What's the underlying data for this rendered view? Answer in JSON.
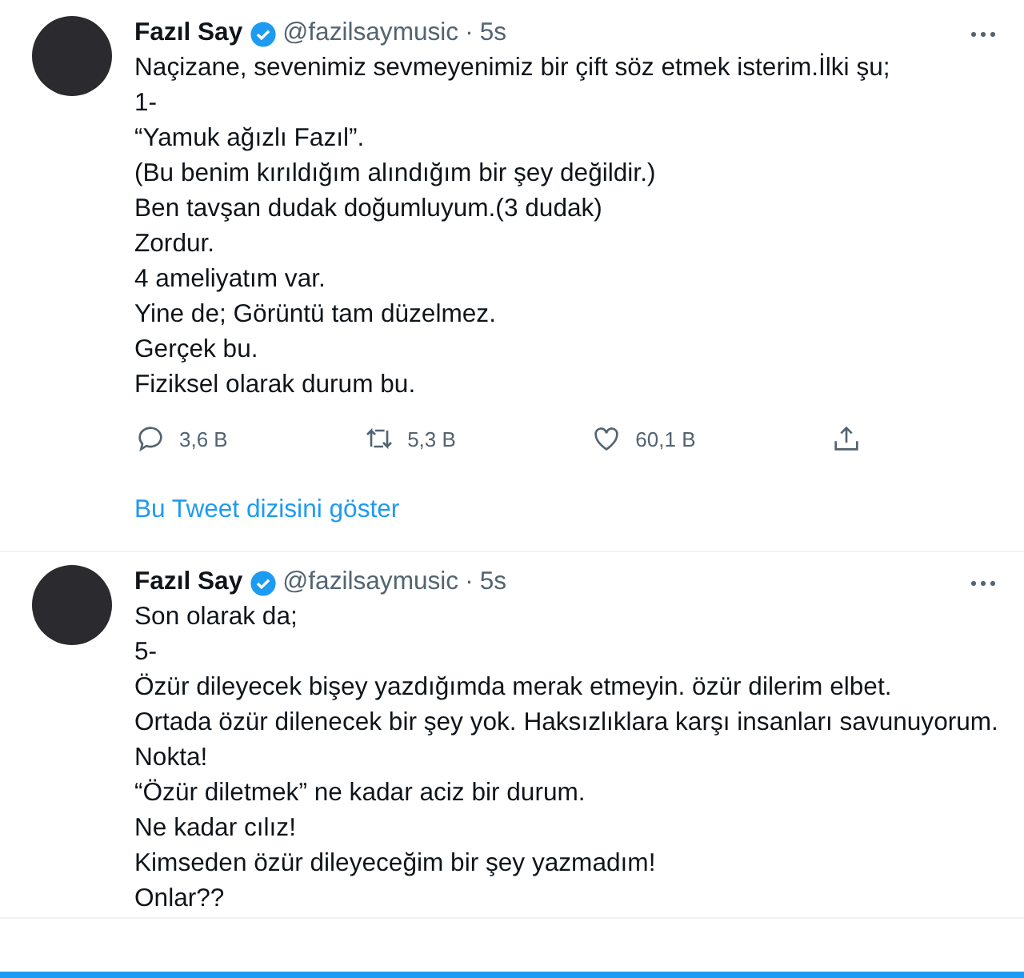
{
  "tweets": [
    {
      "name": "Fazıl Say",
      "verified": true,
      "handle": "@fazilsaymusic",
      "separator": "·",
      "time": "5s",
      "lines": [
        "Naçizane, sevenimiz sevmeyenimiz bir çift söz etmek isterim.İlki şu;",
        "1-",
        "“Yamuk ağızlı Fazıl”.",
        "(Bu benim kırıldığım alındığım bir şey değildir.)",
        "Ben tavşan dudak doğumluyum.(3 dudak)",
        "Zordur.",
        "4 ameliyatım var.",
        "Yine de; Görüntü tam düzelmez.",
        "Gerçek bu.",
        "Fiziksel olarak durum bu."
      ],
      "actions": [
        {
          "kind": "reply",
          "count": "3,6 B"
        },
        {
          "kind": "retweet",
          "count": "5,3 B"
        },
        {
          "kind": "like",
          "count": "60,1 B"
        },
        {
          "kind": "share"
        }
      ],
      "thread_link": "Bu Tweet dizisini göster"
    },
    {
      "name": "Fazıl Say",
      "verified": true,
      "handle": "@fazilsaymusic",
      "separator": "·",
      "time": "5s",
      "lines": [
        "Son olarak da;",
        "5-",
        "Özür dileyecek bişey yazdığımda merak etmeyin. özür dilerim elbet.",
        "Ortada özür dilenecek bir şey yok. Haksızlıklara karşı insanları savunuyorum.",
        "Nokta!",
        "“Özür diletmek” ne kadar aciz bir durum.",
        "Ne kadar cılız!",
        "Kimseden özür dileyeceğim bir şey yazmadım!",
        "Onlar??"
      ]
    }
  ]
}
